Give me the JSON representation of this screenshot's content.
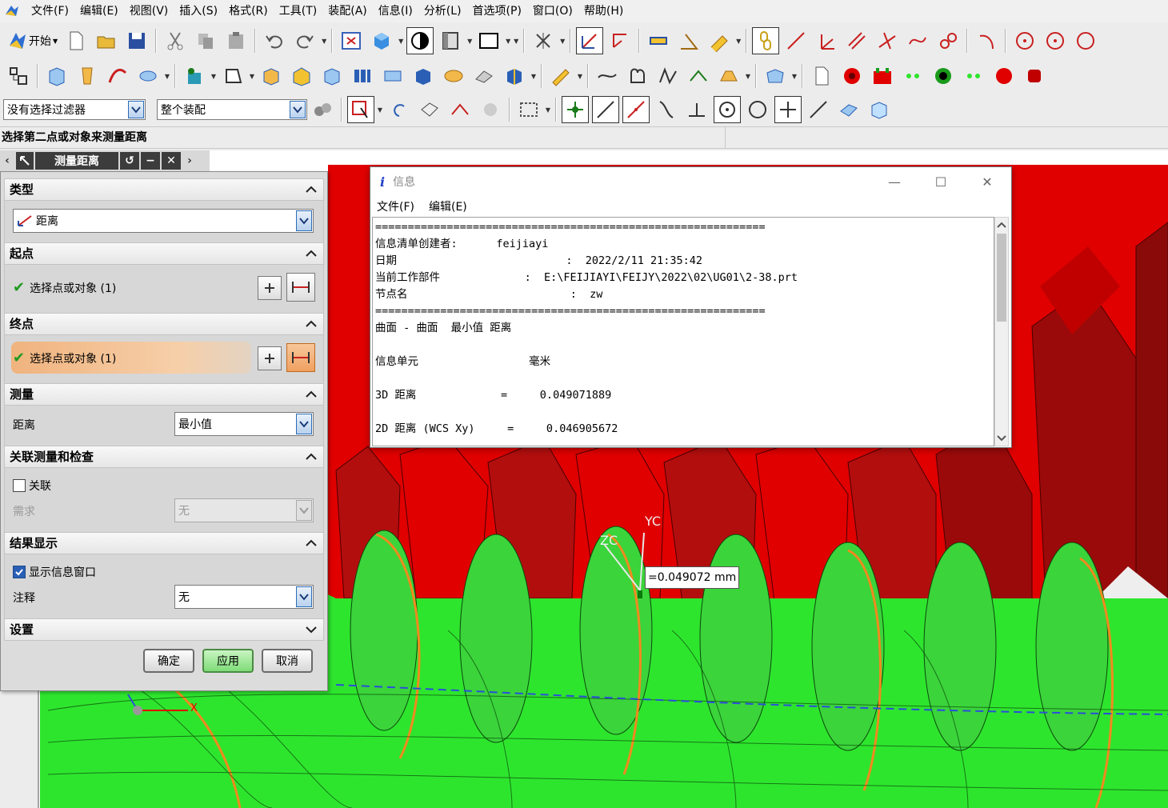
{
  "menu": [
    "文件(F)",
    "编辑(E)",
    "视图(V)",
    "插入(S)",
    "格式(R)",
    "工具(T)",
    "装配(A)",
    "信息(I)",
    "分析(L)",
    "首选项(P)",
    "窗口(O)",
    "帮助(H)"
  ],
  "toolbar": {
    "start_label": "开始",
    "filter_value": "没有选择过滤器",
    "assembly_value": "整个装配"
  },
  "prompt_text": "选择第二点或对象来测量距离",
  "dialog": {
    "title": "测量距离",
    "sections": {
      "type": "类型",
      "start": "起点",
      "end": "终点",
      "measure": "测量",
      "assoc": "关联测量和检查",
      "result": "结果显示",
      "settings": "设置"
    },
    "type_value": "距离",
    "start_label": "选择点或对象 (1)",
    "end_label": "选择点或对象 (1)",
    "distance_label": "距离",
    "distance_value": "最小值",
    "assoc_label": "关联",
    "require_label": "需求",
    "require_value": "无",
    "show_info_label": "显示信息窗口",
    "annotation_label": "注释",
    "annotation_value": "无",
    "ok": "确定",
    "apply": "应用",
    "cancel": "取消"
  },
  "info_window": {
    "title": "信息",
    "menu": [
      "文件(F)",
      "编辑(E)"
    ],
    "lines": [
      "============================================================",
      "信息清单创建者:      feijiayi",
      "日期                          :  2022/2/11 21:35:42",
      "当前工作部件             :  E:\\FEIJIAYI\\FEIJY\\2022\\02\\UG01\\2-38.prt",
      "节点名                         :  zw",
      "============================================================",
      "曲面 - 曲面  最小值 距离",
      "",
      "信息单元                 毫米",
      "",
      "3D 距离             =     0.049071889",
      "",
      "2D 距离 (WCS Xy)     =     0.046905672"
    ]
  },
  "viewport": {
    "tooltip": "=0.049072 mm",
    "axis_zc": "ZC",
    "axis_yc": "YC",
    "axis_x": "X"
  },
  "colors": {
    "red_gear": "#e00000",
    "dark_red": "#9a0a0a",
    "green_worm": "#2ee52e",
    "orange_edge": "#f08a1e"
  }
}
